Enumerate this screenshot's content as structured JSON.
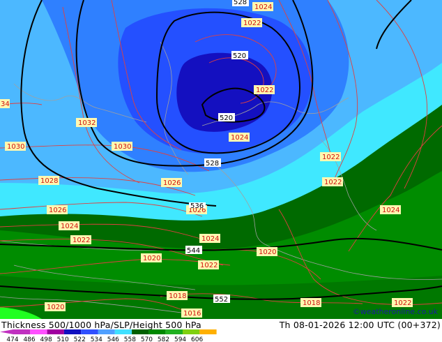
{
  "footer": {
    "title": "Thickness 500/1000 hPa/SLP/Height 500 hPa",
    "date": "Th 08-01-2026 12:00 UTC (00+372)",
    "credit": "©weatheronline.co.uk"
  },
  "legend": {
    "values": [
      "474",
      "486",
      "498",
      "510",
      "522",
      "534",
      "546",
      "558",
      "570",
      "582",
      "594",
      "606"
    ],
    "colors": [
      "#c030c0",
      "#ff50ff",
      "#a000a0",
      "#1010c0",
      "#3050ff",
      "#50a0ff",
      "#40e0ff",
      "#006000",
      "#008800",
      "#20b020",
      "#80d010",
      "#ffb000"
    ]
  },
  "map": {
    "slp_labels": [
      "1024",
      "1022",
      "1022",
      "1032",
      "1030",
      "1030",
      "1028",
      "1026",
      "1026",
      "1024",
      "1022",
      "1020",
      "1018",
      "1016",
      "1020",
      "1022",
      "1024",
      "1022",
      "1022",
      "1024",
      "1018",
      "1022",
      "1020",
      "1026",
      "34"
    ],
    "height_labels": [
      "528",
      "520",
      "520",
      "528",
      "536",
      "544",
      "552"
    ]
  }
}
